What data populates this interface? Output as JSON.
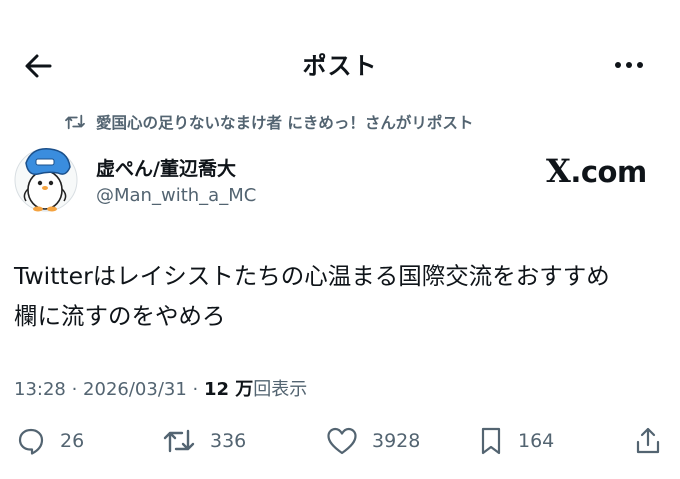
{
  "header": {
    "title": "ポスト"
  },
  "repost_banner": {
    "text": "愛国心の足りないなまけ者 にきめっ！さんがリポスト"
  },
  "author": {
    "name": "虚ぺん/董辺喬大",
    "handle": "@Man_with_a_MC"
  },
  "xcom": {
    "x": "X",
    "suffix": ".com"
  },
  "post": {
    "text_line1": "Twitterはレイシストたちの心温まる国際交流をおすすめ",
    "text_line2": "欄に流すのをやめろ"
  },
  "meta": {
    "time": "13:28",
    "date": "2026/03/31",
    "views_count": "12 万",
    "views_label": "回表示"
  },
  "actions": {
    "replies": "26",
    "reposts": "336",
    "likes": "3928",
    "bookmarks": "164"
  },
  "icons": {
    "back": "arrow-left-icon",
    "more": "more-horizontal-icon",
    "repost": "repost-icon",
    "reply": "reply-bubble-icon",
    "like": "heart-icon",
    "bookmark": "bookmark-icon",
    "share": "share-icon"
  },
  "colors": {
    "text": "#0f1419",
    "secondary": "#536471",
    "background": "#ffffff"
  }
}
